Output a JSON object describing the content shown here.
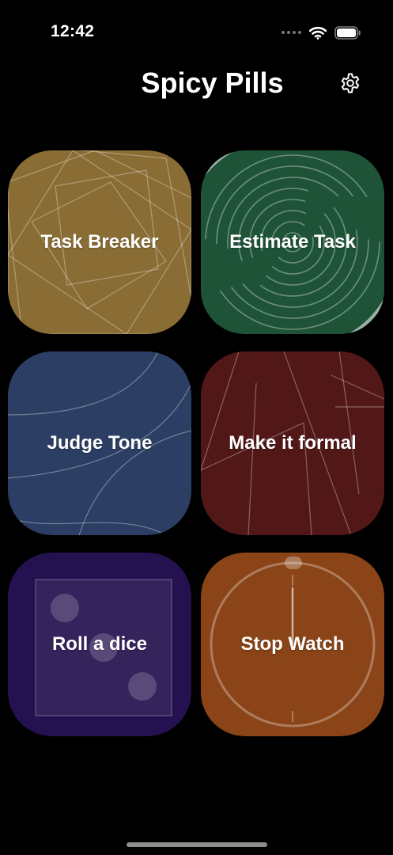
{
  "status_bar": {
    "time": "12:42",
    "icons": [
      "signal-dots-icon",
      "wifi-icon",
      "battery-icon"
    ]
  },
  "header": {
    "title": "Spicy Pills",
    "settings_icon": "gear-icon"
  },
  "tiles": [
    {
      "label": "Task Breaker",
      "color": "#8a6d35"
    },
    {
      "label": "Estimate Task",
      "color": "#1f5338"
    },
    {
      "label": "Judge Tone",
      "color": "#2c3e63"
    },
    {
      "label": "Make it formal",
      "color": "#521818"
    },
    {
      "label": "Roll a dice",
      "color": "#24114f"
    },
    {
      "label": "Stop Watch",
      "color": "#8a4417"
    }
  ]
}
